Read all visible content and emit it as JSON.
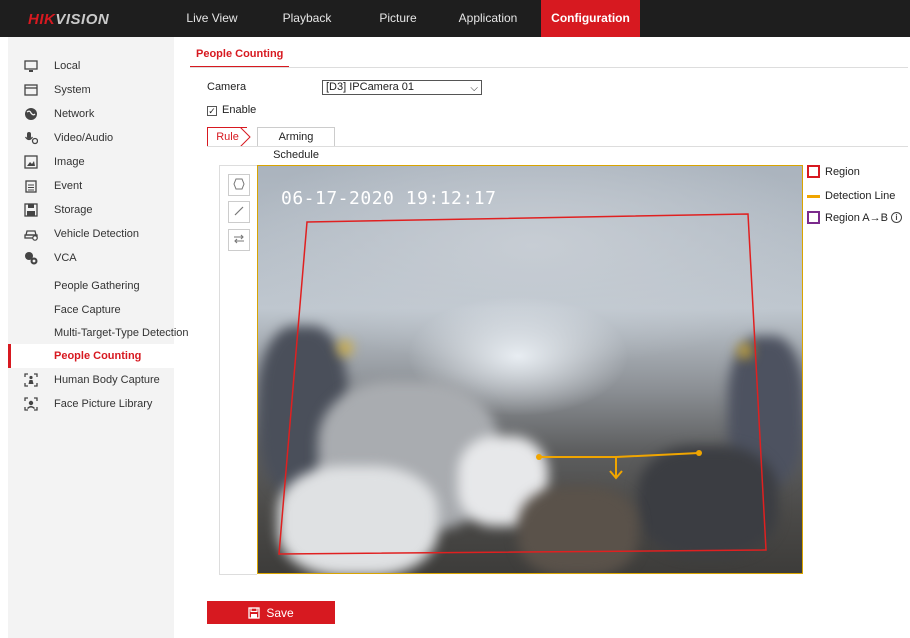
{
  "brand": {
    "logo_prefix": "HIK",
    "logo_suffix": "VISION"
  },
  "nav": {
    "items": [
      {
        "label": "Live View"
      },
      {
        "label": "Playback"
      },
      {
        "label": "Picture"
      },
      {
        "label": "Application"
      },
      {
        "label": "Configuration",
        "active": true
      }
    ]
  },
  "sidebar": {
    "items": [
      {
        "label": "Local",
        "icon": "monitor-icon"
      },
      {
        "label": "System",
        "icon": "window-icon"
      },
      {
        "label": "Network",
        "icon": "globe-icon"
      },
      {
        "label": "Video/Audio",
        "icon": "microphone-icon"
      },
      {
        "label": "Image",
        "icon": "image-icon"
      },
      {
        "label": "Event",
        "icon": "calendar-icon"
      },
      {
        "label": "Storage",
        "icon": "disk-icon"
      },
      {
        "label": "Vehicle Detection",
        "icon": "vehicle-icon"
      },
      {
        "label": "VCA",
        "icon": "vca-icon"
      }
    ],
    "sub_items": [
      {
        "label": "People Gathering"
      },
      {
        "label": "Face Capture"
      },
      {
        "label": "Multi-Target-Type Detection"
      },
      {
        "label": "People Counting",
        "active": true
      }
    ],
    "extra_items": [
      {
        "label": "Human Body Capture",
        "icon": "human-body-icon"
      },
      {
        "label": "Face Picture Library",
        "icon": "face-library-icon"
      }
    ]
  },
  "main": {
    "page_tab": "People Counting",
    "camera_label": "Camera",
    "camera_value": "[D3] IPCamera 01",
    "enable_label": "Enable",
    "enable_checked": true,
    "subtabs": {
      "rule": "Rule",
      "arming": "Arming Schedule"
    },
    "timestamp": "06-17-2020 19:12:17",
    "legend": {
      "region": "Region",
      "detection_line": "Detection Line",
      "region_ab": "Region A→B"
    },
    "save_label": "Save"
  },
  "colors": {
    "accent": "#d71920",
    "detection_line": "#f0a500",
    "region_ab": "#7b2a8c"
  }
}
